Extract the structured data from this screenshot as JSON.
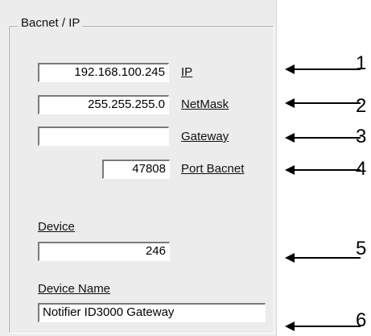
{
  "group": {
    "title": "Bacnet / IP"
  },
  "fields": {
    "ip_value": "192.168.100.245",
    "netmask_value": "255.255.255.0",
    "gateway_value": "",
    "port_value": "47808",
    "device_value": "246",
    "device_name_value": "Notifier ID3000 Gateway"
  },
  "labels": {
    "ip": "IP",
    "netmask": "NetMask",
    "gateway": "Gateway",
    "port": "Port Bacnet",
    "device": "Device",
    "device_name": "Device Name"
  },
  "callouts": [
    "1",
    "2",
    "3",
    "4",
    "5",
    "6"
  ],
  "colors": {
    "panel": "#ececec",
    "field": "#ffffff",
    "text": "#111111",
    "arrow": "#000000"
  }
}
